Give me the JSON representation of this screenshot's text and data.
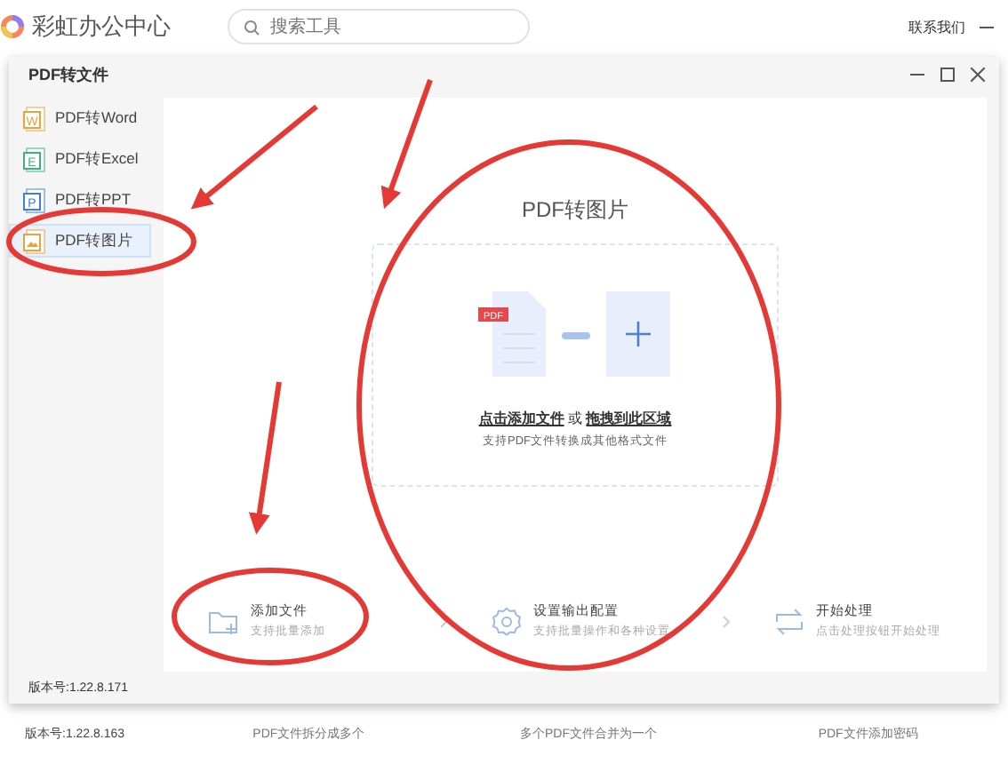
{
  "app_bar": {
    "title": "彩虹办公中心",
    "search": {
      "placeholder": "搜索工具"
    },
    "contact": "联系我们"
  },
  "dialog": {
    "title": "PDF转文件",
    "sidebar": {
      "items": [
        {
          "label": "PDF转Word",
          "icon_text": "W",
          "color": "#e8a33c",
          "selected": false
        },
        {
          "label": "PDF转Excel",
          "icon_text": "E",
          "color": "#3bb37a",
          "selected": false
        },
        {
          "label": "PDF转PPT",
          "icon_text": "P",
          "color": "#3f7fd9",
          "selected": false
        },
        {
          "label": "PDF转图片",
          "color": "#e8a33c",
          "selected": true
        }
      ]
    },
    "panel": {
      "title": "PDF转图片",
      "badge": "PDF",
      "drop_text": "**点击添加文件** 或 **拖拽到此区域**",
      "drop_hint": "支持PDF文件转换成其他格式文件"
    },
    "steps": [
      {
        "kind": "add",
        "title": "添加文件",
        "subtitle": "支持批量添加"
      },
      {
        "kind": "settings",
        "title": "设置输出配置",
        "subtitle": "支持批量操作和各种设置"
      },
      {
        "kind": "process",
        "title": "开始处理",
        "subtitle": "点击处理按钮开始处理"
      }
    ],
    "version": "版本号:1.22.8.171"
  },
  "background": {
    "version": "版本号:1.22.8.163",
    "tools": [
      {
        "caption": "PDF文件拆分成多个"
      },
      {
        "caption": "多个PDF文件合并为一个"
      },
      {
        "caption": "PDF文件添加密码"
      }
    ]
  }
}
